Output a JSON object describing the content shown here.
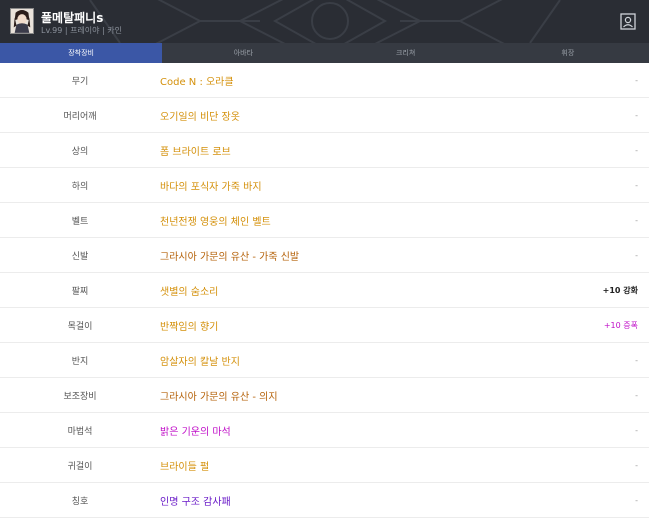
{
  "character": {
    "name": "풀메탈패니s",
    "info": "Lv.99 | 프레이야 | 카인",
    "avatar_icon": "character-avatar-icon",
    "profile_icon": "profile-card-icon"
  },
  "tabs": [
    {
      "label": "장착장비",
      "active": true
    },
    {
      "label": "아바타",
      "active": false
    },
    {
      "label": "크리쳐",
      "active": false
    },
    {
      "label": "휘장",
      "active": false
    }
  ],
  "equipment": [
    {
      "slot": "무기",
      "item": "Code N : 오라클",
      "extra": "-",
      "color": "#d4900a"
    },
    {
      "slot": "머리어깨",
      "item": "오기일의 비단 장옷",
      "extra": "-",
      "color": "#d4900a"
    },
    {
      "slot": "상의",
      "item": "폼 브라이트 로브",
      "extra": "-",
      "color": "#d4900a"
    },
    {
      "slot": "하의",
      "item": "바다의 포식자 가죽 바지",
      "extra": "-",
      "color": "#d4900a"
    },
    {
      "slot": "벨트",
      "item": "천년전쟁 영웅의 체인 벨트",
      "extra": "-",
      "color": "#d4900a"
    },
    {
      "slot": "신발",
      "item": "그라시아 가문의 유산 - 가죽 신발",
      "extra": "-",
      "color": "#b5620a"
    },
    {
      "slot": "팔찌",
      "item": "샛별의 숨소리",
      "extra": "+10 강화",
      "color": "#d4900a"
    },
    {
      "slot": "목걸이",
      "item": "반짝임의 향기",
      "extra": "+10 증폭",
      "color": "#d4900a"
    },
    {
      "slot": "반지",
      "item": "암살자의 칼날 반지",
      "extra": "-",
      "color": "#d4900a"
    },
    {
      "slot": "보조장비",
      "item": "그라시아 가문의 유산 - 의지",
      "extra": "-",
      "color": "#b5620a"
    },
    {
      "slot": "마법석",
      "item": "밝은 기운의 마석",
      "extra": "-",
      "color": "#c010c8"
    },
    {
      "slot": "귀걸이",
      "item": "브라이들 펄",
      "extra": "-",
      "color": "#d4900a"
    },
    {
      "slot": "칭호",
      "item": "인명 구조 감사패",
      "extra": "-",
      "color": "#6a1bc8"
    }
  ],
  "colors": {
    "header_bg": "#2a2d34",
    "tab_active": "#3b57a6",
    "tab_bar": "#363a42"
  }
}
